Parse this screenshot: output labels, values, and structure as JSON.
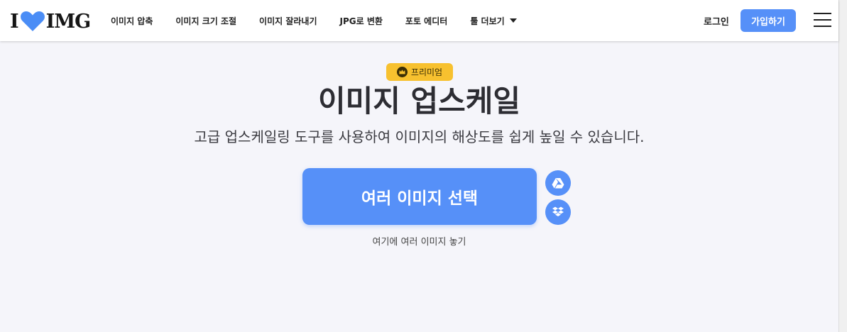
{
  "header": {
    "logo": {
      "left": "I",
      "right": "IMG"
    },
    "nav": [
      {
        "label": "이미지 압축"
      },
      {
        "label": "이미지 크기 조절"
      },
      {
        "label": "이미지 잘라내기"
      },
      {
        "label": "JPG로 변환"
      },
      {
        "label": "포토 에디터"
      },
      {
        "label": "툴 더보기"
      }
    ],
    "login_label": "로그인",
    "signup_label": "가입하기"
  },
  "hero": {
    "badge_label": "프리미엄",
    "title": "이미지 업스케일",
    "subtitle": "고급 업스케일링 도구를 사용하여 이미지의 해상도를 쉽게 높일 수 있습니다.",
    "upload_label": "여러 이미지 선택",
    "drop_hint": "여기에 여러 이미지 놓기"
  },
  "icons": {
    "logo_heart": "heart-icon",
    "badge": "crown-icon",
    "cloud_1": "google-drive-icon",
    "cloud_2": "dropbox-icon",
    "menu": "hamburger-menu-icon",
    "nav_more": "caret-down-icon"
  },
  "colors": {
    "accent": "#5690f8",
    "badge": "#f7c12f",
    "background": "#f5f5fa",
    "text": "#2d2d33"
  }
}
